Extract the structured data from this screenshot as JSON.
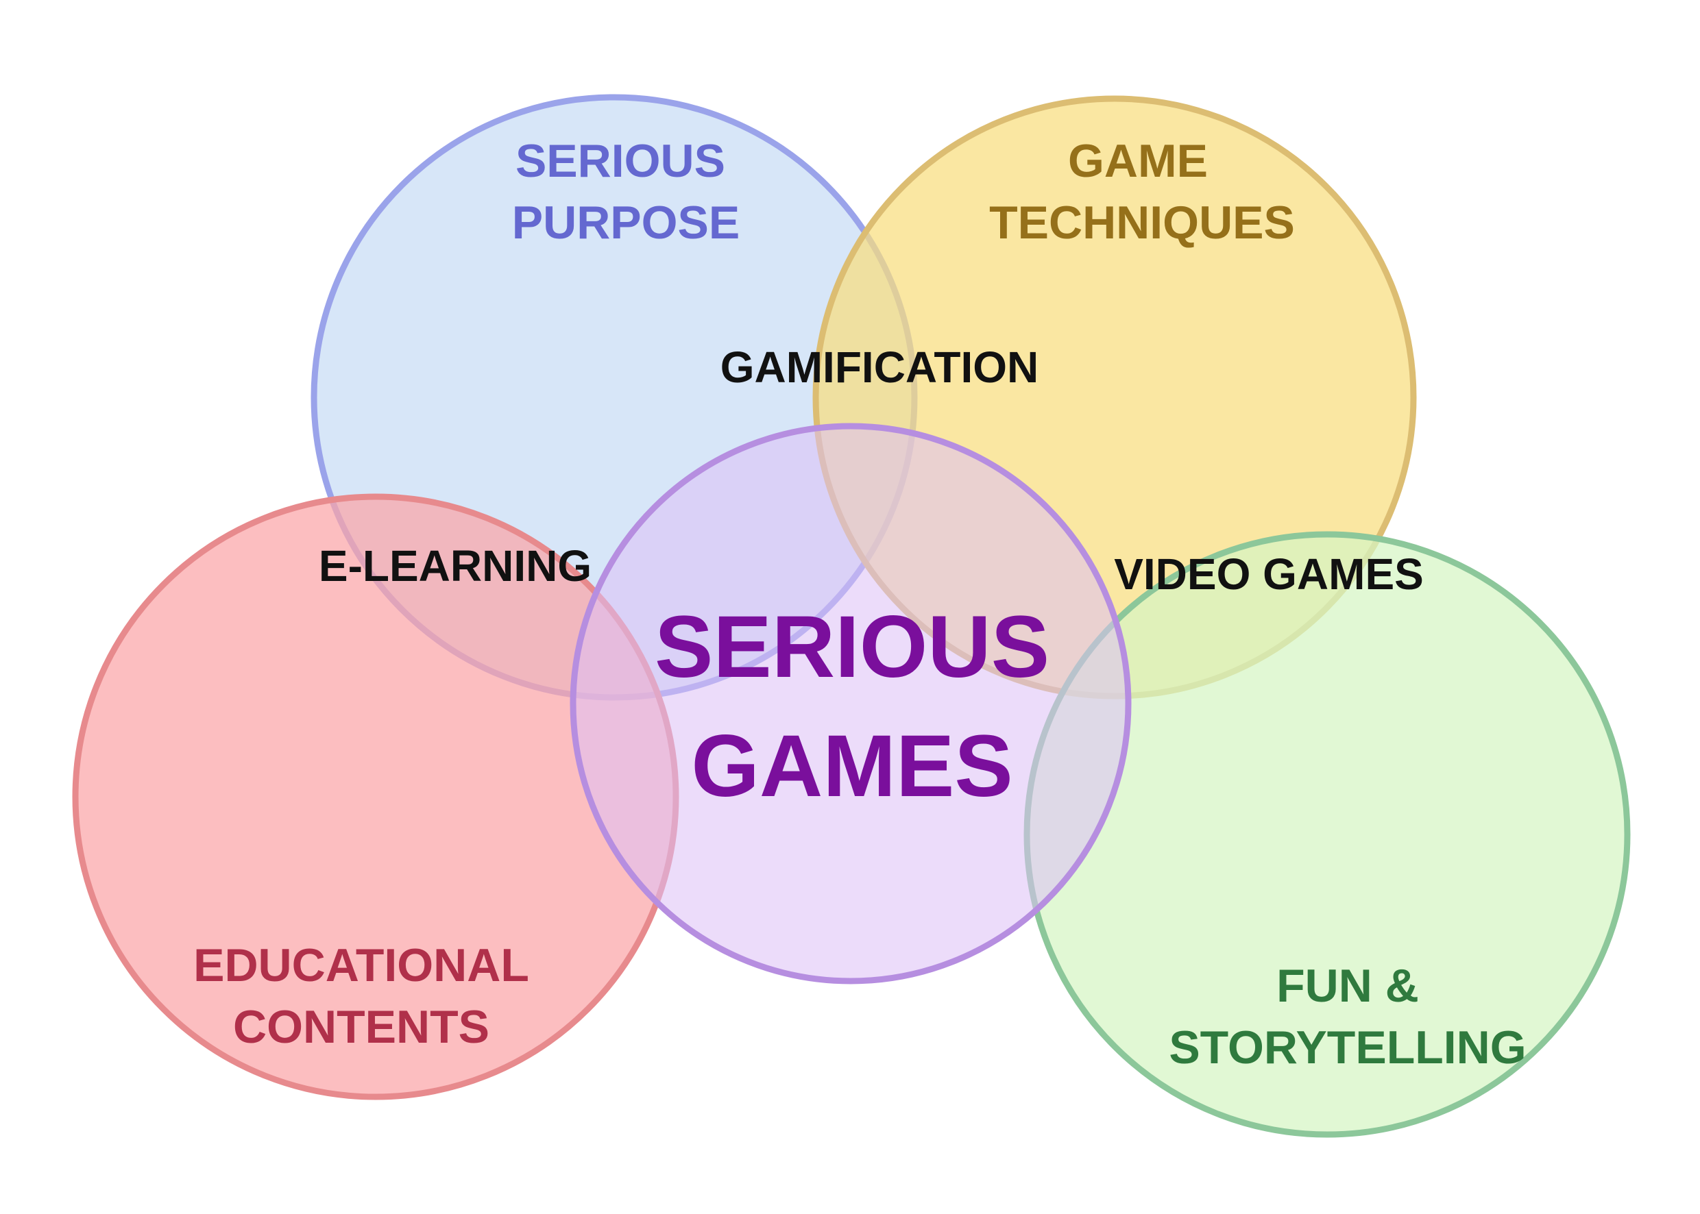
{
  "diagram": {
    "sets": {
      "serious_purpose": {
        "line1": "SERIOUS",
        "line2": "PURPOSE",
        "fill": "#c8dcf5",
        "stroke": "#9aa3ea",
        "text_color": "#6468d0"
      },
      "game_techniques": {
        "line1": "GAME",
        "line2": "TECHNIQUES",
        "fill": "#f8de7e",
        "stroke": "#dcbd72",
        "text_color": "#95701a"
      },
      "educational_contents": {
        "line1": "EDUCATIONAL",
        "line2": "CONTENTS",
        "fill": "#fba5a8",
        "stroke": "#e78a8d",
        "text_color": "#b0304a"
      },
      "fun_storytelling": {
        "line1": "FUN &",
        "line2": "STORYTELLING",
        "fill": "#d5f5c4",
        "stroke": "#8cc79a",
        "text_color": "#2f7a3e"
      },
      "serious_games": {
        "line1": "SERIOUS",
        "line2": "GAMES",
        "fill": "#dcc0f5",
        "stroke": "#b68ee0",
        "text_color": "#7a0f9c"
      }
    },
    "overlaps": {
      "gamification": "GAMIFICATION",
      "e_learning": "E-LEARNING",
      "video_games": "VIDEO GAMES"
    }
  }
}
